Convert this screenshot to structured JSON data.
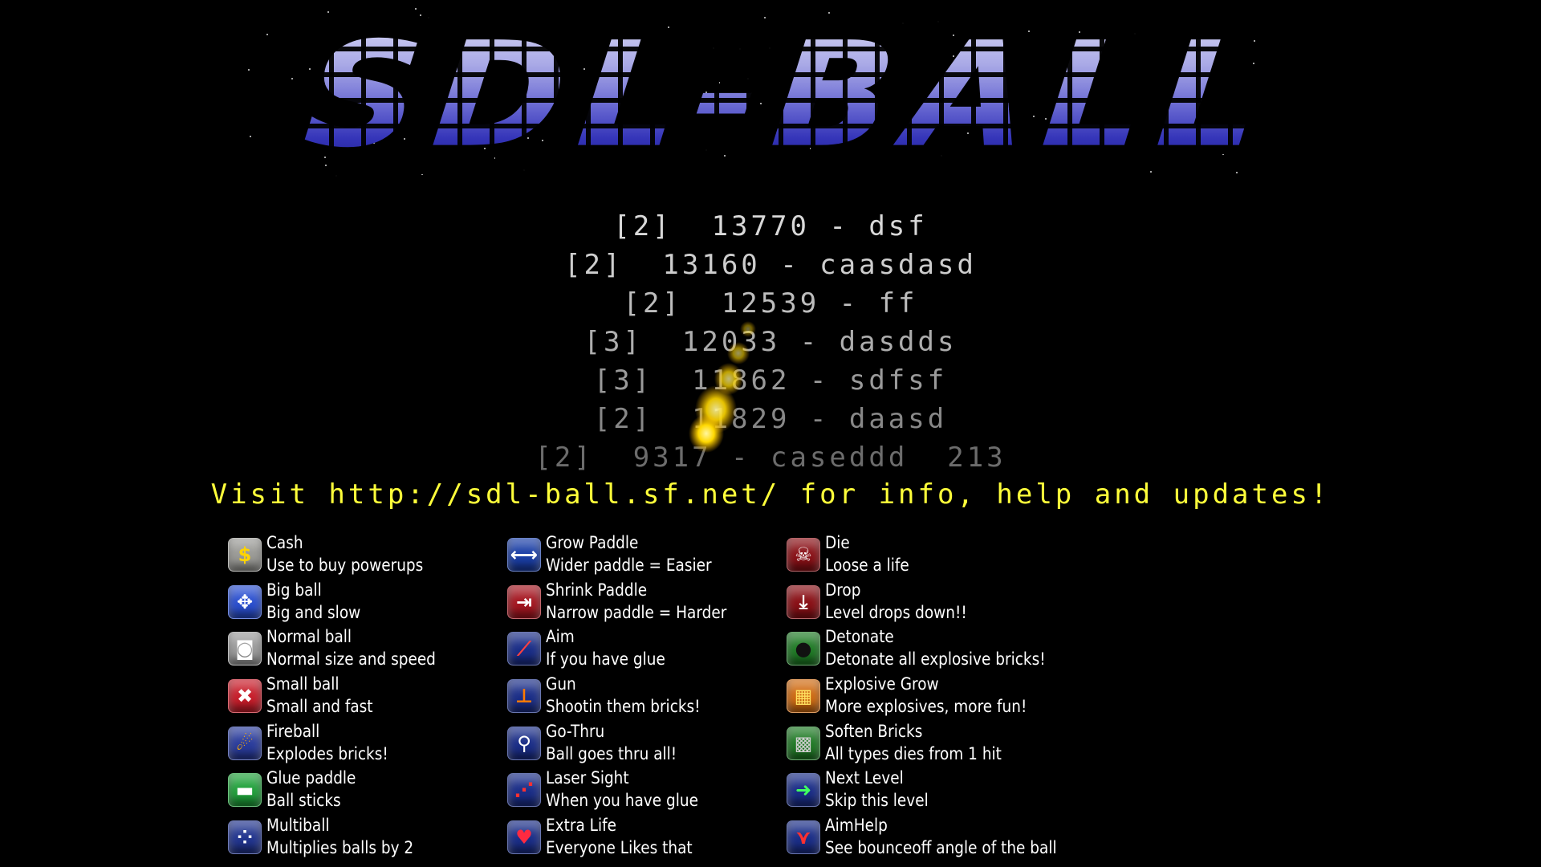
{
  "logo": {
    "text": "SDL-BALL"
  },
  "highscores": [
    {
      "text": "[2]  13770 - dsf",
      "color": "#d8d8d8"
    },
    {
      "text": "[2]  13160 - caasdasd",
      "color": "#cdcdcd"
    },
    {
      "text": "[2]  12539 - ff",
      "color": "#bdbdbd"
    },
    {
      "text": "[3]  12033 - dasdds",
      "color": "#adadad"
    },
    {
      "text": "[3]  11862 - sdfsf",
      "color": "#9a9a9a"
    },
    {
      "text": "[2]  11829 - daasd",
      "color": "#878787"
    },
    {
      "text": "[2]  9317 - caseddd  213",
      "color": "#6c6c6c"
    }
  ],
  "info_link": "Visit http://sdl-ball.sf.net/ for info, help and updates!",
  "powerups": {
    "col1": [
      {
        "name": "Cash",
        "desc": "Use to buy powerups",
        "icon": "dollar-icon",
        "glyph": "$",
        "color": "#9a9a96",
        "glyph_color": "#ffd400"
      },
      {
        "name": "Big ball",
        "desc": "Big and slow",
        "icon": "expand-arrows-icon",
        "glyph": "✥",
        "color": "#2a4fd0",
        "glyph_color": "#ffffff"
      },
      {
        "name": "Normal ball",
        "desc": "Normal size and speed",
        "icon": "normal-ball-icon",
        "glyph": "◙",
        "color": "#9c9c9c",
        "glyph_color": "#ffffff"
      },
      {
        "name": "Small ball",
        "desc": "Small and fast",
        "icon": "shrink-arrows-icon",
        "glyph": "✖",
        "color": "#c81d2a",
        "glyph_color": "#ffffff"
      },
      {
        "name": "Fireball",
        "desc": "Explodes bricks!",
        "icon": "fireball-icon",
        "glyph": "☄",
        "color": "#2a3c9c",
        "glyph_color": "#ffb000"
      },
      {
        "name": "Glue paddle",
        "desc": "Ball sticks",
        "icon": "glue-paddle-icon",
        "glyph": "▬",
        "color": "#1fa13a",
        "glyph_color": "#ffffff"
      },
      {
        "name": "Multiball",
        "desc": "Multiplies balls by 2",
        "icon": "multiball-icon",
        "glyph": "⁘",
        "color": "#22358f",
        "glyph_color": "#ffffff"
      }
    ],
    "col2": [
      {
        "name": "Grow Paddle",
        "desc": "Wider paddle = Easier",
        "icon": "grow-paddle-icon",
        "glyph": "⟷",
        "color": "#1a3ea6",
        "glyph_color": "#ffffff"
      },
      {
        "name": "Shrink Paddle",
        "desc": "Narrow paddle = Harder",
        "icon": "shrink-paddle-icon",
        "glyph": "⇥",
        "color": "#a51620",
        "glyph_color": "#ffffff"
      },
      {
        "name": "Aim",
        "desc": "If you have glue",
        "icon": "aim-icon",
        "glyph": "⟋",
        "color": "#1b2e88",
        "glyph_color": "#ff4040"
      },
      {
        "name": "Gun",
        "desc": "Shootin them bricks!",
        "icon": "gun-icon",
        "glyph": "⊥",
        "color": "#1b2e88",
        "glyph_color": "#ff7a00"
      },
      {
        "name": "Go-Thru",
        "desc": "Ball goes thru all!",
        "icon": "go-thru-icon",
        "glyph": "⚲",
        "color": "#1b2e88",
        "glyph_color": "#ffffff"
      },
      {
        "name": "Laser Sight",
        "desc": "When you have glue",
        "icon": "laser-sight-icon",
        "glyph": "⋰",
        "color": "#1b2e88",
        "glyph_color": "#ff3030"
      },
      {
        "name": "Extra Life",
        "desc": "Everyone Likes that",
        "icon": "heart-icon",
        "glyph": "♥",
        "color": "#1b2e88",
        "glyph_color": "#ff2a40"
      }
    ],
    "col3": [
      {
        "name": "Die",
        "desc": "Loose a life",
        "icon": "skull-icon",
        "glyph": "☠",
        "color": "#8a1016",
        "glyph_color": "#ffffff"
      },
      {
        "name": "Drop",
        "desc": "Level drops down!!",
        "icon": "drop-arrow-icon",
        "glyph": "⤓",
        "color": "#8a1016",
        "glyph_color": "#ffffff"
      },
      {
        "name": "Detonate",
        "desc": "Detonate all explosive bricks!",
        "icon": "bomb-icon",
        "glyph": "●",
        "color": "#1e7a24",
        "glyph_color": "#111111"
      },
      {
        "name": "Explosive Grow",
        "desc": "More explosives, more fun!",
        "icon": "explosive-bricks-icon",
        "glyph": "▦",
        "color": "#d06a10",
        "glyph_color": "#ffe060"
      },
      {
        "name": "Soften Bricks",
        "desc": "All types dies from 1 hit",
        "icon": "soften-bricks-icon",
        "glyph": "▩",
        "color": "#1e7a24",
        "glyph_color": "#cfcfcf"
      },
      {
        "name": "Next Level",
        "desc": "Skip this level",
        "icon": "next-level-arrow-icon",
        "glyph": "➜",
        "color": "#1b2e88",
        "glyph_color": "#40ff60"
      },
      {
        "name": "AimHelp",
        "desc": "See bounceoff angle of the ball",
        "icon": "aim-help-icon",
        "glyph": "⋎",
        "color": "#1b2e88",
        "glyph_color": "#ff3030"
      }
    ]
  }
}
